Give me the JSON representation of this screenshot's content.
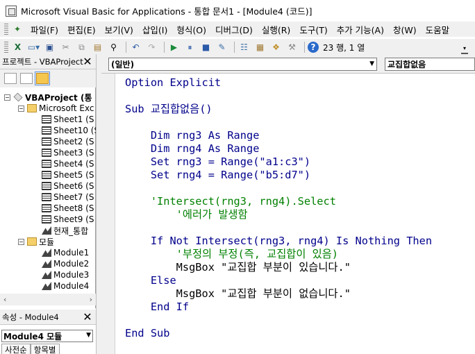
{
  "window": {
    "title": "Microsoft Visual Basic for Applications - 통합 문서1 - [Module4 (코드)]"
  },
  "menubar": {
    "items": [
      "파일(F)",
      "편집(E)",
      "보기(V)",
      "삽입(I)",
      "형식(O)",
      "디버그(D)",
      "실행(R)",
      "도구(T)",
      "추가 기능(A)",
      "창(W)",
      "도움말"
    ]
  },
  "toolbar": {
    "cursor_position": "23 행, 1 열"
  },
  "project_pane": {
    "title": "프로젝트 - VBAProject",
    "tree": [
      {
        "label": "VBAProject (통",
        "expander": "−",
        "icon": "vba-project-icon"
      },
      {
        "label": "Microsoft Exc",
        "expander": "−",
        "icon": "folder-icon"
      },
      {
        "label": "Sheet1 (S",
        "icon": "sheet-icon"
      },
      {
        "label": "Sheet10 (S",
        "icon": "sheet-icon"
      },
      {
        "label": "Sheet2 (S",
        "icon": "sheet-icon"
      },
      {
        "label": "Sheet3 (S",
        "icon": "sheet-icon"
      },
      {
        "label": "Sheet4 (S",
        "icon": "sheet-icon"
      },
      {
        "label": "Sheet5 (S",
        "icon": "sheet-icon"
      },
      {
        "label": "Sheet6 (S",
        "icon": "sheet-icon"
      },
      {
        "label": "Sheet7 (S",
        "icon": "sheet-icon"
      },
      {
        "label": "Sheet8 (S",
        "icon": "sheet-icon"
      },
      {
        "label": "Sheet9 (S",
        "icon": "sheet-icon"
      },
      {
        "label": "현재_통합",
        "icon": "workbook-icon"
      },
      {
        "label": "모듈",
        "expander": "−",
        "icon": "folder-icon"
      },
      {
        "label": "Module1",
        "icon": "module-icon"
      },
      {
        "label": "Module2",
        "icon": "module-icon"
      },
      {
        "label": "Module3",
        "icon": "module-icon"
      },
      {
        "label": "Module4",
        "icon": "module-icon"
      }
    ]
  },
  "properties_pane": {
    "title": "속성 - Module4",
    "object_select": "Module4 모듈",
    "tabs": [
      "사전순",
      "항목별"
    ]
  },
  "code_window": {
    "object_combo": "(일반)",
    "procedure_combo": "교집합없음",
    "lines": [
      {
        "text": "Option Explicit",
        "style": "kw"
      },
      {
        "text": "",
        "style": "tx"
      },
      {
        "text": "Sub 교집합없음()",
        "style": "kw"
      },
      {
        "text": "",
        "style": "tx"
      },
      {
        "text": "    Dim rng3 As Range",
        "style": "kw"
      },
      {
        "text": "    Dim rng4 As Range",
        "style": "kw"
      },
      {
        "text": "    Set rng3 = Range(\"a1:c3\")",
        "style": "kw"
      },
      {
        "text": "    Set rng4 = Range(\"b5:d7\")",
        "style": "kw"
      },
      {
        "text": "",
        "style": "tx"
      },
      {
        "text": "    'Intersect(rng3, rng4).Select",
        "style": "cm"
      },
      {
        "text": "        '에러가 발생함",
        "style": "cm"
      },
      {
        "text": "",
        "style": "tx"
      },
      {
        "text": "    If Not Intersect(rng3, rng4) Is Nothing Then",
        "style": "kw"
      },
      {
        "text": "        '부정의 부정(즉, 교집합이 있음)",
        "style": "cm"
      },
      {
        "text": "        MsgBox \"교집합 부분이 있습니다.\"",
        "style": "tx"
      },
      {
        "text": "    Else",
        "style": "kw"
      },
      {
        "text": "        MsgBox \"교집합 부분이 없습니다.\"",
        "style": "tx"
      },
      {
        "text": "    End If",
        "style": "kw"
      },
      {
        "text": "",
        "style": "tx"
      },
      {
        "text": "End Sub",
        "style": "kw"
      }
    ]
  },
  "colors": {
    "keyword": "#00008b",
    "comment": "#008000",
    "chrome": "#f0f0f0"
  }
}
